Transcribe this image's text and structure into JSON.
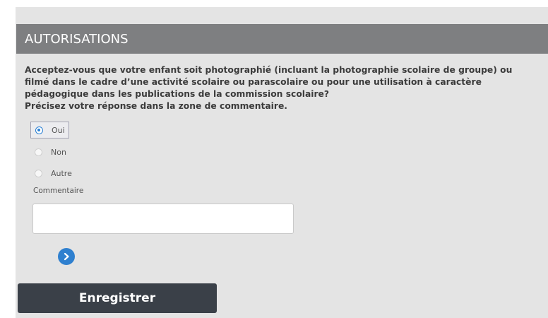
{
  "section": {
    "title": "AUTORISATIONS"
  },
  "question": {
    "lines": [
      "Acceptez-vous que votre enfant soit photographié (incluant la photographie scolaire de groupe) ou",
      "filmé dans le cadre d’une activité scolaire ou parascolaire ou pour une utilisation à caractère",
      "pédagogique dans les publications de la commission scolaire?",
      "Précisez votre réponse dans la zone de commentaire."
    ]
  },
  "options": [
    {
      "label": "Oui",
      "selected": true
    },
    {
      "label": "Non",
      "selected": false
    },
    {
      "label": "Autre",
      "selected": false
    }
  ],
  "comment": {
    "label": "Commentaire",
    "value": "",
    "placeholder": ""
  },
  "next_icon": "chevron-right-icon",
  "save_label": "Enregistrer",
  "colors": {
    "panel_bg": "#e4e4e4",
    "header_bg": "#7e7f81",
    "accent": "#2f80cf",
    "save_bg": "#3a4048"
  }
}
